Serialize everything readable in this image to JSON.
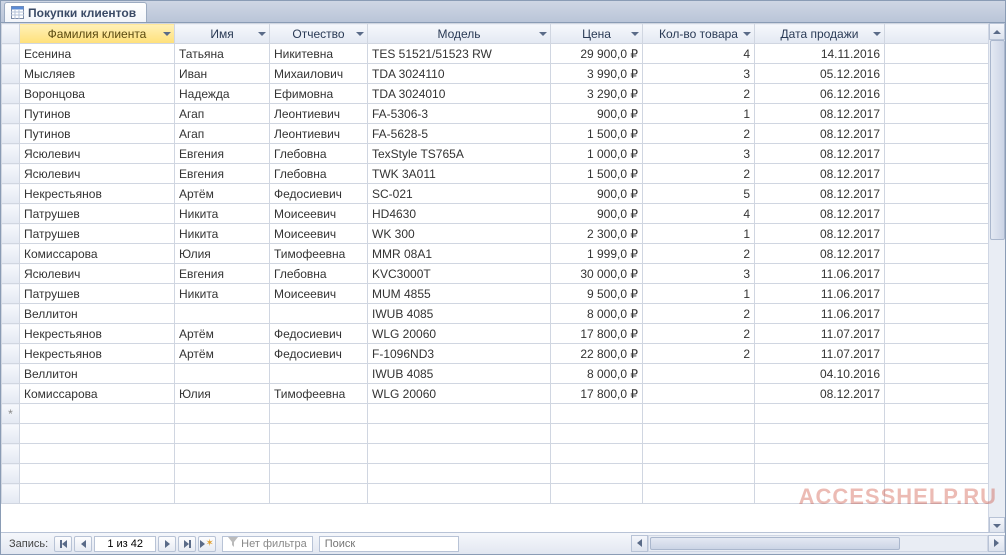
{
  "tab": {
    "title": "Покупки клиентов"
  },
  "columns": {
    "c0": "Фамилия клиента",
    "c1": "Имя",
    "c2": "Отчество",
    "c3": "Модель",
    "c4": "Цена",
    "c5": "Кол-во товара",
    "c6": "Дата продажи"
  },
  "rows": [
    {
      "lname": "Есенина",
      "fname": "Татьяна",
      "pname": "Никитевна",
      "model": "TES 51521/51523 RW",
      "price": "29 900,0 ₽",
      "qty": "4",
      "date": "14.11.2016"
    },
    {
      "lname": "Мысляев",
      "fname": "Иван",
      "pname": "Михаилович",
      "model": "TDA 3024110",
      "price": "3 990,0 ₽",
      "qty": "3",
      "date": "05.12.2016"
    },
    {
      "lname": "Воронцова",
      "fname": "Надежда",
      "pname": "Ефимовна",
      "model": "TDA 3024010",
      "price": "3 290,0 ₽",
      "qty": "2",
      "date": "06.12.2016"
    },
    {
      "lname": "Путинов",
      "fname": "Агап",
      "pname": "Леонтиевич",
      "model": "FA-5306-3",
      "price": "900,0 ₽",
      "qty": "1",
      "date": "08.12.2017"
    },
    {
      "lname": "Путинов",
      "fname": "Агап",
      "pname": "Леонтиевич",
      "model": "FA-5628-5",
      "price": "1 500,0 ₽",
      "qty": "2",
      "date": "08.12.2017"
    },
    {
      "lname": "Ясюлевич",
      "fname": "Евгения",
      "pname": "Глебовна",
      "model": "TexStyle TS765A",
      "price": "1 000,0 ₽",
      "qty": "3",
      "date": "08.12.2017"
    },
    {
      "lname": "Ясюлевич",
      "fname": "Евгения",
      "pname": "Глебовна",
      "model": "TWK 3A011",
      "price": "1 500,0 ₽",
      "qty": "2",
      "date": "08.12.2017"
    },
    {
      "lname": "Некрестьянов",
      "fname": "Артём",
      "pname": "Федосиевич",
      "model": "SC-021",
      "price": "900,0 ₽",
      "qty": "5",
      "date": "08.12.2017"
    },
    {
      "lname": "Патрушев",
      "fname": "Никита",
      "pname": "Моисеевич",
      "model": "HD4630",
      "price": "900,0 ₽",
      "qty": "4",
      "date": "08.12.2017"
    },
    {
      "lname": "Патрушев",
      "fname": "Никита",
      "pname": "Моисеевич",
      "model": "WK 300",
      "price": "2 300,0 ₽",
      "qty": "1",
      "date": "08.12.2017"
    },
    {
      "lname": "Комиссарова",
      "fname": "Юлия",
      "pname": "Тимофеевна",
      "model": "MMR 08A1",
      "price": "1 999,0 ₽",
      "qty": "2",
      "date": "08.12.2017"
    },
    {
      "lname": "Ясюлевич",
      "fname": "Евгения",
      "pname": "Глебовна",
      "model": "KVC3000T",
      "price": "30 000,0 ₽",
      "qty": "3",
      "date": "11.06.2017"
    },
    {
      "lname": "Патрушев",
      "fname": "Никита",
      "pname": "Моисеевич",
      "model": "MUM 4855",
      "price": "9 500,0 ₽",
      "qty": "1",
      "date": "11.06.2017"
    },
    {
      "lname": "Веллитон",
      "fname": "",
      "pname": "",
      "model": "IWUB 4085",
      "price": "8 000,0 ₽",
      "qty": "2",
      "date": "11.06.2017"
    },
    {
      "lname": "Некрестьянов",
      "fname": "Артём",
      "pname": "Федосиевич",
      "model": "WLG 20060",
      "price": "17 800,0 ₽",
      "qty": "2",
      "date": "11.07.2017"
    },
    {
      "lname": "Некрестьянов",
      "fname": "Артём",
      "pname": "Федосиевич",
      "model": "F-1096ND3",
      "price": "22 800,0 ₽",
      "qty": "2",
      "date": "11.07.2017"
    },
    {
      "lname": "Веллитон",
      "fname": "",
      "pname": "",
      "model": "IWUB 4085",
      "price": "8 000,0 ₽",
      "qty": "",
      "date": "04.10.2016"
    },
    {
      "lname": "Комиссарова",
      "fname": "Юлия",
      "pname": "Тимофеевна",
      "model": "WLG 20060",
      "price": "17 800,0 ₽",
      "qty": "",
      "date": "08.12.2017"
    }
  ],
  "nav": {
    "label": "Запись:",
    "position": "1 из 42",
    "filter_label": "Нет фильтра",
    "search_placeholder": "Поиск"
  },
  "watermark": "ACCESSHELP.RU"
}
